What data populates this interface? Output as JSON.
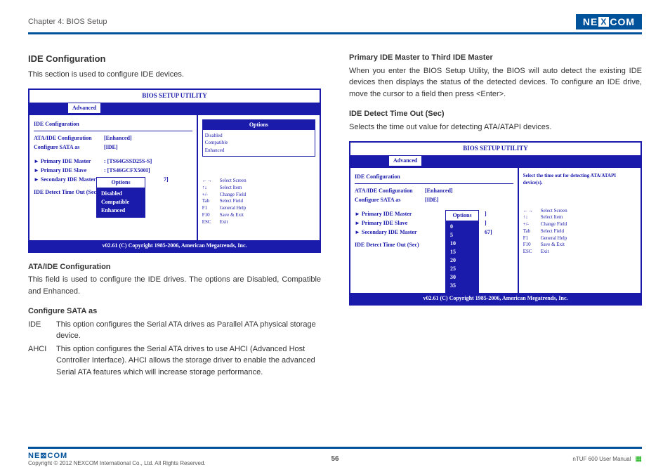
{
  "header": {
    "chapter": "Chapter 4: BIOS Setup",
    "brand_pre": "NE",
    "brand_x": "X",
    "brand_post": "COM"
  },
  "left": {
    "title": "IDE Configuration",
    "intro": "This section is used to configure IDE devices.",
    "ata_title": "ATA/IDE Configuration",
    "ata_body": "This field is used to configure the IDE drives. The options are Disabled, Compatible and Enhanced.",
    "sata_title": "Configure SATA as",
    "sata_ide_t": "IDE",
    "sata_ide_b": "This option configures the Serial ATA drives as Parallel ATA physical storage device.",
    "sata_ahci_t": "AHCI",
    "sata_ahci_b": "This option configures the Serial ATA drives to use AHCI (Advanced Host Controller Interface). AHCI allows the storage driver to enable the advanced Serial ATA features which will increase storage performance."
  },
  "right": {
    "p1_title": "Primary IDE Master to Third IDE Master",
    "p1_body": "When you enter the BIOS Setup Utility, the BIOS will auto detect the existing IDE devices then displays the status of the detected devices. To configure an IDE drive, move the cursor to a field then press <Enter>.",
    "p2_title": "IDE Detect Time Out (Sec)",
    "p2_body": "Selects the time out value for detecting ATA/ATAPI devices."
  },
  "bios": {
    "title": "BIOS SETUP UTILITY",
    "tab": "Advanced",
    "heading": "IDE Configuration",
    "l1": "ATA/IDE Configuration",
    "v1": "[Enhanced]",
    "l2": "Configure SATA as",
    "v2": "[IDE]",
    "m1": "► Primary IDE Master",
    "m1v": ":   [TS64GSSD25S-S]",
    "m2": "► Primary IDE Slave",
    "m2v": ":   [TS46GCFX500I]",
    "m3": "► Secondary IDE Master",
    "m3v": "7]",
    "det": "IDE Detect Time Out (Sec)",
    "detv": "67]",
    "cr": "v02.61 (C) Copyright 1985-2006, American Megatrends, Inc.",
    "opt_panel_t": "Options",
    "opt1": "Disabled",
    "opt2": "Compatible",
    "opt3": "Enhanced",
    "popup_t": "Options",
    "help2": "Select the time out for detecting ATA/ATAPI device(s).",
    "timeouts": [
      "0",
      "5",
      "10",
      "15",
      "20",
      "25",
      "30",
      "35"
    ],
    "keys": [
      [
        "←→",
        "Select Screen"
      ],
      [
        "↑↓",
        "Select Item"
      ],
      [
        "+/-",
        "Change Field"
      ],
      [
        "Tab",
        "Select Field"
      ],
      [
        "F1",
        "General Help"
      ],
      [
        "F10",
        "Save & Exit"
      ],
      [
        "ESC",
        "Exit"
      ]
    ]
  },
  "footer": {
    "logo": "NE⊠COM",
    "cr": "Copyright © 2012 NEXCOM International Co., Ltd. All Rights Reserved.",
    "page": "56",
    "manual": "nTUF 600 User Manual"
  }
}
